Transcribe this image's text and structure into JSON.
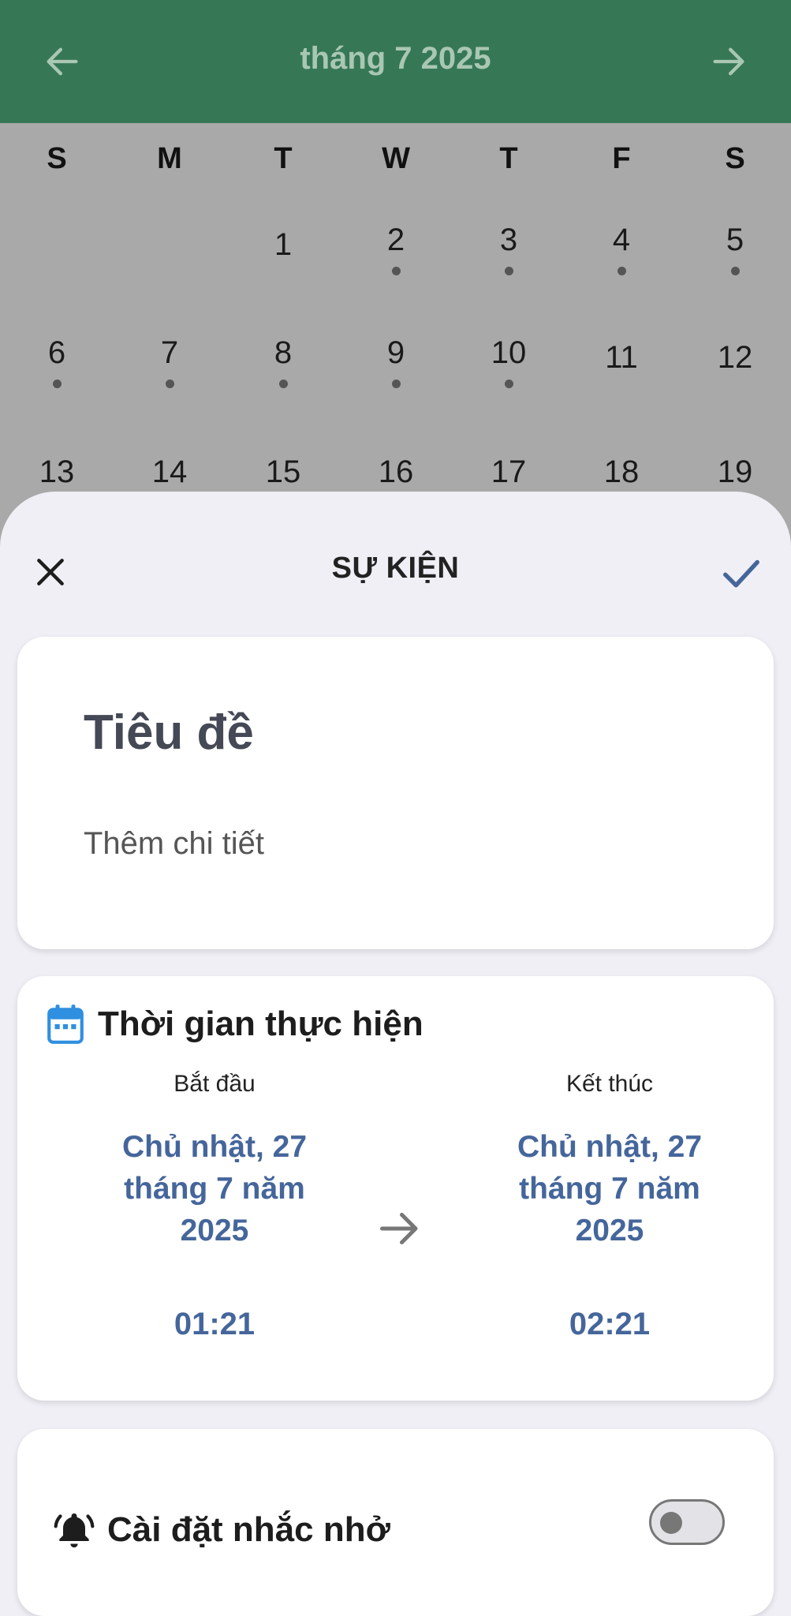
{
  "header": {
    "month_title": "tháng 7 2025"
  },
  "calendar": {
    "weekdays": [
      "S",
      "M",
      "T",
      "W",
      "T",
      "F",
      "S"
    ],
    "weeks": [
      [
        {
          "d": ""
        },
        {
          "d": ""
        },
        {
          "d": "1",
          "dot": false
        },
        {
          "d": "2",
          "dot": true
        },
        {
          "d": "3",
          "dot": true
        },
        {
          "d": "4",
          "dot": true
        },
        {
          "d": "5",
          "dot": true
        }
      ],
      [
        {
          "d": "6",
          "dot": true
        },
        {
          "d": "7",
          "dot": true
        },
        {
          "d": "8",
          "dot": true
        },
        {
          "d": "9",
          "dot": true
        },
        {
          "d": "10",
          "dot": true
        },
        {
          "d": "11",
          "dot": false
        },
        {
          "d": "12",
          "dot": false
        }
      ],
      [
        {
          "d": "13",
          "dot": false
        },
        {
          "d": "14",
          "dot": false
        },
        {
          "d": "15",
          "dot": false
        },
        {
          "d": "16",
          "dot": false
        },
        {
          "d": "17",
          "dot": false
        },
        {
          "d": "18",
          "dot": false
        },
        {
          "d": "19",
          "dot": false
        }
      ]
    ]
  },
  "sheet": {
    "title": "SỰ KIỆN",
    "title_placeholder": "Tiêu đề",
    "detail_placeholder": "Thêm chi tiết"
  },
  "time_section": {
    "label": "Thời gian thực hiện",
    "start": {
      "caption": "Bắt đầu",
      "date_line1": "Chủ nhật, 27",
      "date_line2": "tháng 7 năm",
      "date_line3": "2025",
      "time": "01:21"
    },
    "end": {
      "caption": "Kết thúc",
      "date_line1": "Chủ nhật, 27",
      "date_line2": "tháng 7 năm",
      "date_line3": "2025",
      "time": "02:21"
    }
  },
  "reminder": {
    "label": "Cài đặt nhắc nhở",
    "enabled": false
  },
  "colors": {
    "header_bg": "#367856",
    "accent_blue": "#45669b",
    "calendar_icon": "#2f8fe0"
  }
}
